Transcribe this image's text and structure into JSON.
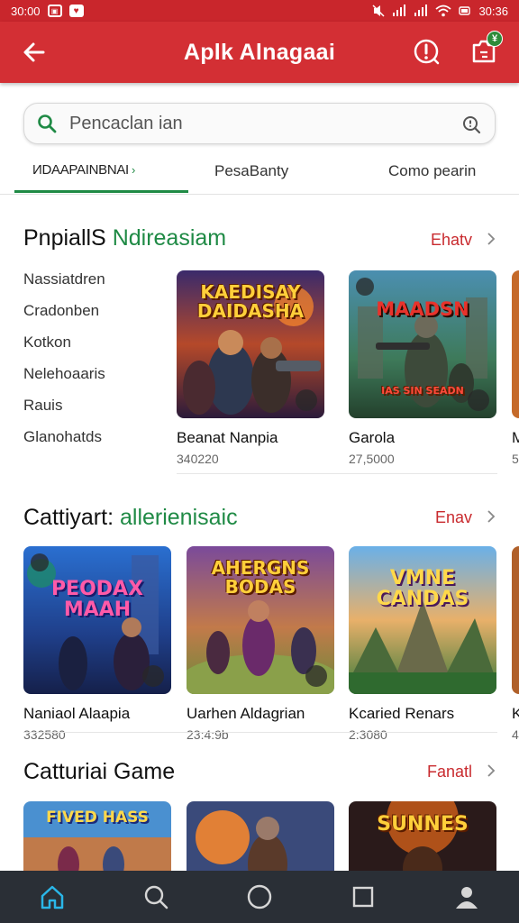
{
  "status_bar": {
    "time_left": "30:00",
    "time_right": "30:36"
  },
  "app_bar": {
    "title": "Aplk Alnagaai",
    "notification_badge": "¥"
  },
  "search": {
    "placeholder": "Pencaclan ian"
  },
  "tabs": [
    {
      "label": "ИDAAPAINBNAI",
      "active": true
    },
    {
      "label": "PesaBanty",
      "active": false
    },
    {
      "label": "Como pearin",
      "active": false
    }
  ],
  "section1": {
    "title_black": "PnpiallS",
    "title_green": "Ndireasiam",
    "more": "Ehatv",
    "side_items": [
      "Nassiatdren",
      "Cradonben",
      "Kotkon",
      "Nelehoaaris",
      "Rauis",
      "Glanohatds"
    ],
    "cards": [
      {
        "name": "Beanat Nanpia",
        "meta": "340220",
        "art_title": "KAEDISAY DAIDASHA"
      },
      {
        "name": "Garola",
        "meta": "27,5000",
        "art_title": "MAADSN",
        "art_sub": "IAS SIN SEADN"
      },
      {
        "name": "M",
        "meta": "5"
      }
    ]
  },
  "section2": {
    "title_black": "Cattiyart:",
    "title_green": "allerienisaic",
    "more": "Enav",
    "cards": [
      {
        "name": "Naniaol Alaapia",
        "meta": "332580",
        "art_title": "PEODAX MAAH"
      },
      {
        "name": "Uarhen Aldagrian",
        "meta": "23:4:9b",
        "art_title": "AHERGNS BODAS"
      },
      {
        "name": "Kcaried Renars",
        "meta": "2:3080",
        "art_title": "VMNE CANDAS"
      },
      {
        "name": "K",
        "meta": "4"
      }
    ]
  },
  "section3": {
    "title_black": "Catturiai Game",
    "more": "Fanatl",
    "cards": [
      {
        "art_title": "FIVED HASS"
      },
      {
        "art_title": ""
      },
      {
        "art_title": "SUNNES"
      }
    ]
  },
  "colors": {
    "primary_red": "#d32f34",
    "accent_green": "#1f8a45",
    "link_red": "#c92b2f",
    "nav_dark": "#2a2f36",
    "nav_active": "#2ab6e8"
  },
  "icons": {
    "back": "arrow-left-icon",
    "info": "info-circle-icon",
    "notif": "notification-box-icon",
    "search": "search-icon",
    "search_right": "search-icon",
    "nav": [
      "home-icon",
      "search-icon",
      "circle-icon",
      "square-icon",
      "profile-icon"
    ]
  }
}
